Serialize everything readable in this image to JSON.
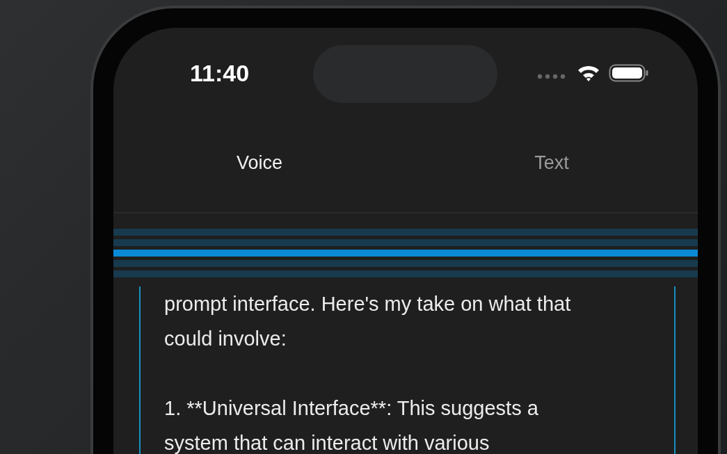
{
  "status_bar": {
    "time": "11:40"
  },
  "tabs": [
    {
      "label": "Voice",
      "selected": true
    },
    {
      "label": "Text",
      "selected": false
    }
  ],
  "message": {
    "paragraphs": [
      [
        "prompt interface. Here's my take on what that",
        "could involve:"
      ],
      [
        "1. **Universal Interface**: This suggests a",
        "system that can interact with various"
      ]
    ]
  }
}
